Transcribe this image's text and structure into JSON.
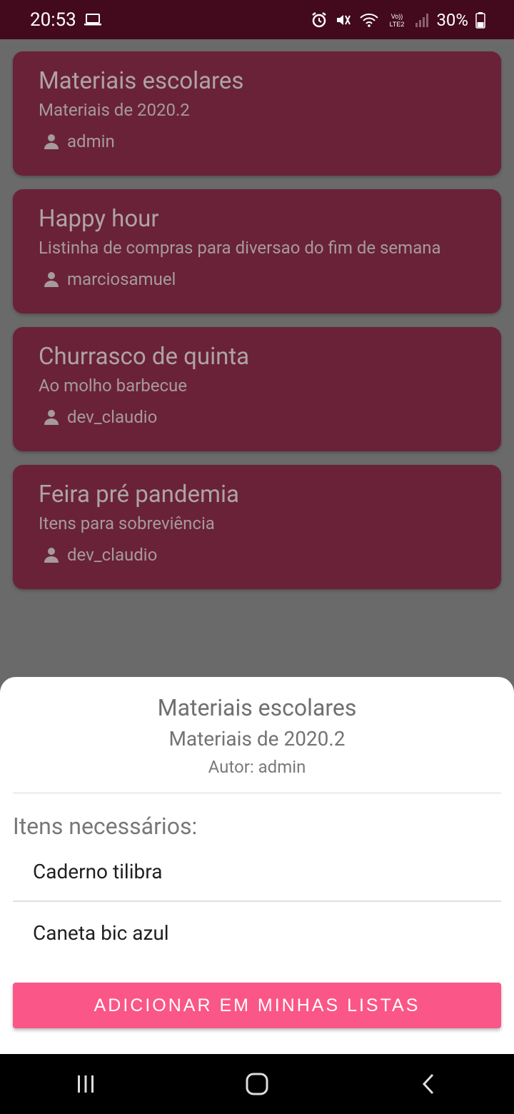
{
  "status_bar": {
    "time": "20:53",
    "battery": "30%",
    "icons": [
      "laptop-icon",
      "alarm-icon",
      "mute-icon",
      "wifi-icon",
      "volte-icon",
      "signal-icon",
      "battery-icon"
    ]
  },
  "lists": [
    {
      "title": "Materiais escolares",
      "subtitle": "Materiais de 2020.2",
      "author": "admin"
    },
    {
      "title": "Happy hour",
      "subtitle": "Listinha de compras para diversao do fim de semana",
      "author": "marciosamuel"
    },
    {
      "title": "Churrasco de quinta",
      "subtitle": "Ao molho barbecue",
      "author": "dev_claudio"
    },
    {
      "title": "Feira pré pandemia",
      "subtitle": "Itens para sobreviência",
      "author": "dev_claudio"
    }
  ],
  "sheet": {
    "title": "Materiais escolares",
    "subtitle": "Materiais de 2020.2",
    "author": "Autor: admin",
    "items_label": "Itens necessários:",
    "items": [
      "Caderno tilibra",
      "Caneta bic azul"
    ],
    "add_button_label": "ADICIONAR EM MINHAS LISTAS"
  },
  "colors": {
    "status_bar": "#420a1c",
    "card": "#6a2239",
    "scrim": "#6a6a6a",
    "accent": "#fb5688"
  },
  "nav_bar": {
    "buttons": [
      "recent-apps-icon",
      "home-icon",
      "back-icon"
    ]
  }
}
